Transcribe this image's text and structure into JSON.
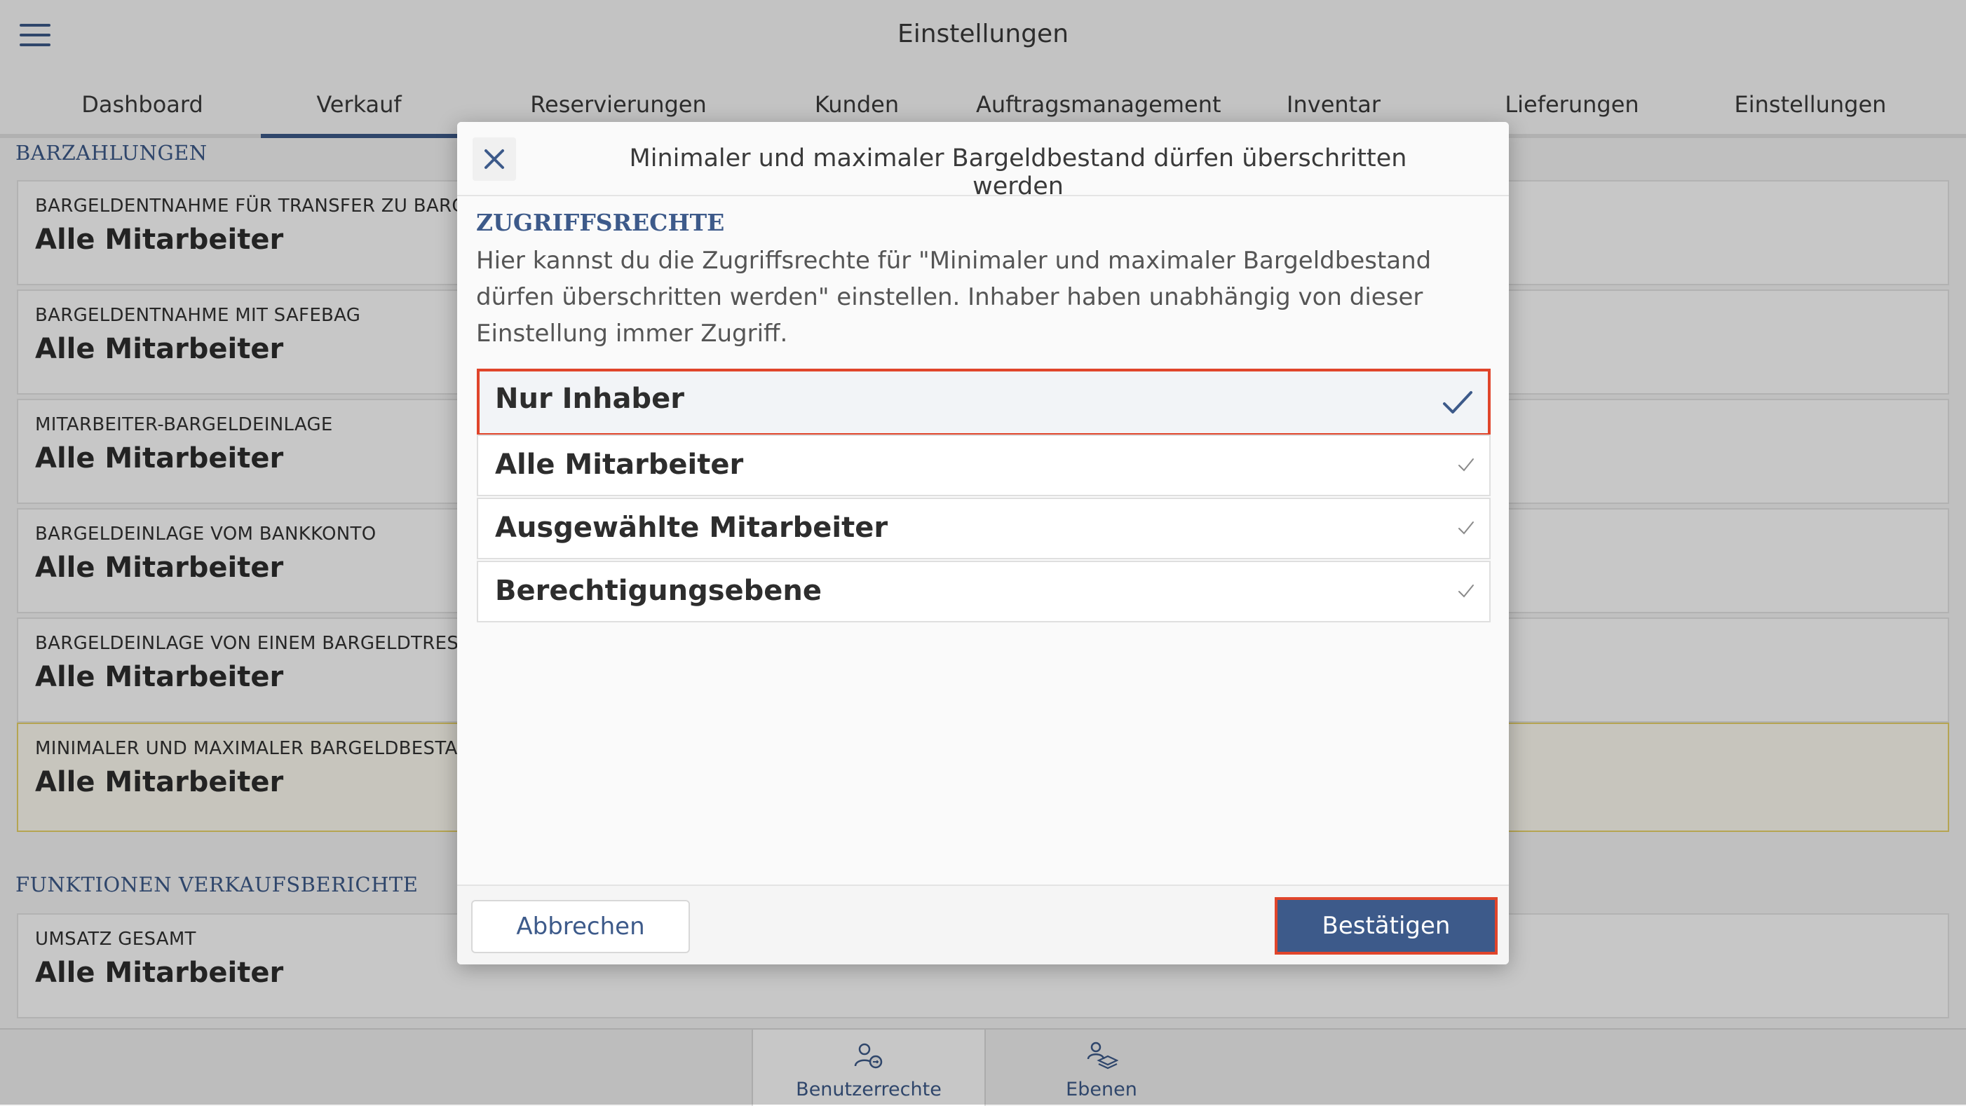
{
  "header": {
    "title": "Einstellungen"
  },
  "tabs": [
    {
      "label": "Dashboard"
    },
    {
      "label": "Verkauf"
    },
    {
      "label": "Reservierungen"
    },
    {
      "label": "Kunden"
    },
    {
      "label": "Auftragsmanagement"
    },
    {
      "label": "Inventar"
    },
    {
      "label": "Lieferungen"
    },
    {
      "label": "Einstellungen"
    }
  ],
  "active_tab": "Verkauf",
  "sections": [
    {
      "title": "BARZAHLUNGEN",
      "settings": [
        {
          "label": "BARGELDENTNAHME FÜR TRANSFER ZU BARGELDT",
          "value": "Alle Mitarbeiter"
        },
        {
          "label": "BARGELDENTNAHME MIT SAFEBAG",
          "value": "Alle Mitarbeiter"
        },
        {
          "label": "MITARBEITER-BARGELDEINLAGE",
          "value": "Alle Mitarbeiter"
        },
        {
          "label": "BARGELDEINLAGE VOM BANKKONTO",
          "value": "Alle Mitarbeiter"
        },
        {
          "label": "BARGELDEINLAGE VON EINEM BARGELDTRESOR",
          "value": "Alle Mitarbeiter"
        },
        {
          "label": "MINIMALER UND MAXIMALER BARGELDBESTAND D",
          "value": "Alle Mitarbeiter"
        }
      ]
    },
    {
      "title": "FUNKTIONEN VERKAUFSBERICHTE",
      "settings": [
        {
          "label": "UMSATZ GESAMT",
          "value": "Alle Mitarbeiter"
        }
      ]
    }
  ],
  "bottom_nav": [
    {
      "label": "Benutzerrechte",
      "icon": "user-permissions-icon"
    },
    {
      "label": "Ebenen",
      "icon": "layers-users-icon"
    }
  ],
  "modal": {
    "title": "Minimaler und maximaler Bargeldbestand dürfen überschritten werden",
    "heading": "ZUGRIFFSRECHTE",
    "description": "Hier kannst du die Zugriffsrechte für \"Minimaler und maximaler Bargeldbestand dürfen überschritten werden\" einstellen. Inhaber haben unabhängig von dieser Einstellung immer Zugriff.",
    "options": [
      {
        "label": "Nur Inhaber",
        "selected": true
      },
      {
        "label": "Alle Mitarbeiter",
        "selected": false
      },
      {
        "label": "Ausgewählte Mitarbeiter",
        "selected": false
      },
      {
        "label": "Berechtigungsebene",
        "selected": false
      }
    ],
    "cancel_label": "Abbrechen",
    "confirm_label": "Bestätigen"
  },
  "colors": {
    "accent": "#3d5a8a",
    "highlight_border": "#e0452b",
    "setting_highlight": "#e8d46a"
  }
}
